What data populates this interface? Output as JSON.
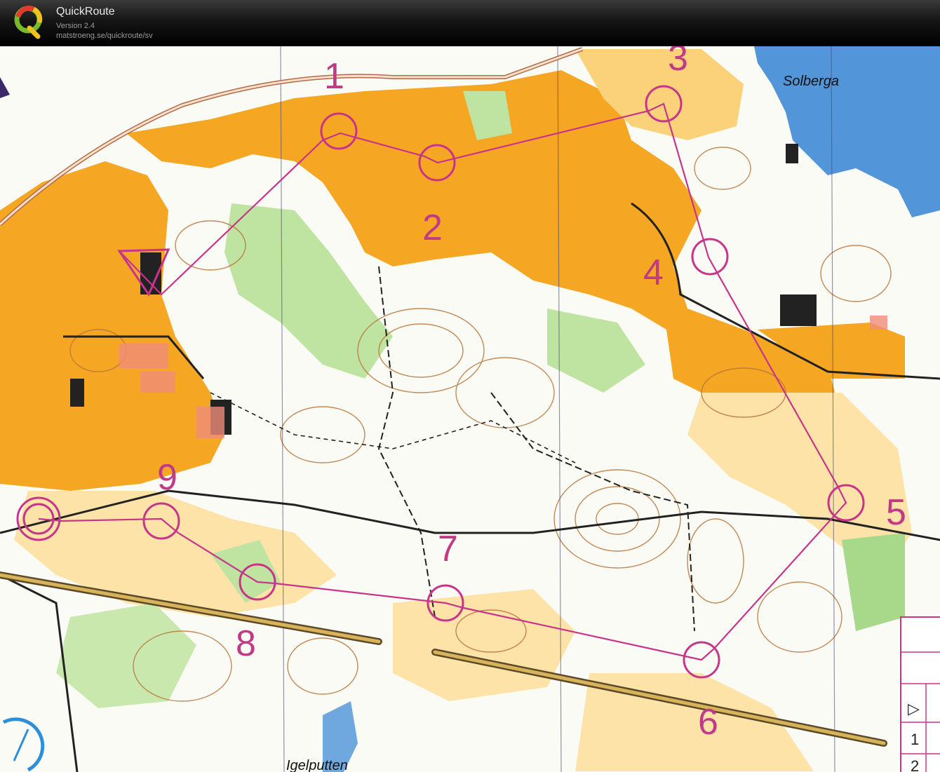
{
  "app": {
    "name": "QuickRoute",
    "version": "Version 2.4",
    "url": "matstroeng.se/quickroute/sv"
  },
  "map": {
    "place_names": [
      "Solberga",
      "Igelputten"
    ],
    "course_color": "#c8348a",
    "controls": [
      {
        "label": "",
        "kind": "start"
      },
      {
        "label": "1"
      },
      {
        "label": "2"
      },
      {
        "label": "3"
      },
      {
        "label": "4"
      },
      {
        "label": "5"
      },
      {
        "label": "6"
      },
      {
        "label": "7"
      },
      {
        "label": "8"
      },
      {
        "label": "9"
      },
      {
        "label": "",
        "kind": "finish"
      }
    ],
    "description_sheet": {
      "rows": [
        "▷",
        "1",
        "2"
      ]
    },
    "colors": {
      "open_land": "#f5a623",
      "rough_open": "#fbd27a",
      "vegetation": "#8cc864",
      "water": "#2f7fd0",
      "contours": "#b8763a",
      "paper": "#fbfbf6"
    }
  }
}
